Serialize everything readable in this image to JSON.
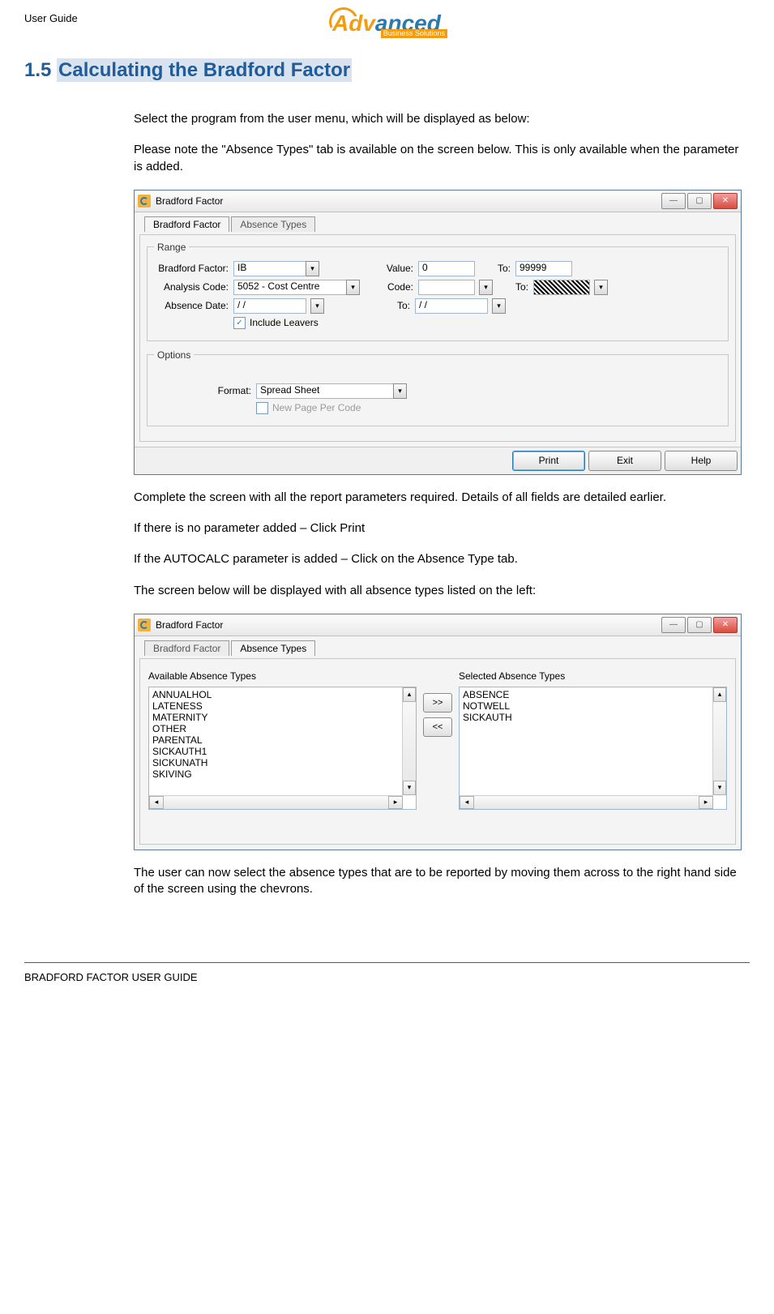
{
  "header": {
    "left_label": "User Guide",
    "logo_orange": "Adv",
    "logo_blue": "anced",
    "logo_sub": "Business Solutions"
  },
  "heading": {
    "number": "1.5",
    "title": "Calculating the Bradford Factor"
  },
  "paragraphs": {
    "p1": "Select the program from the user menu, which will be displayed as below:",
    "p2": "Please note the \"Absence Types\" tab is available on the screen below. This is only available when the parameter is added.",
    "p3": "Complete the screen with all the report parameters required. Details of all fields are detailed earlier.",
    "p4": "If there is no parameter added – Click Print",
    "p5": "If the AUTOCALC parameter is added – Click on the Absence Type tab.",
    "p6": "The screen below will be displayed with all absence types listed on the left:",
    "p7": "The user can now select the absence types that are to be reported by moving them across to the right hand side of the screen using the chevrons."
  },
  "win1": {
    "title": "Bradford Factor",
    "tabs": {
      "t1": "Bradford Factor",
      "t2": "Absence Types"
    },
    "group_range": "Range",
    "group_options": "Options",
    "labels": {
      "bradford_factor": "Bradford Factor:",
      "value": "Value:",
      "to": "To:",
      "analysis_code": "Analysis Code:",
      "code": "Code:",
      "absence_date": "Absence Date:",
      "include_leavers": "Include Leavers",
      "format": "Format:",
      "new_page": "New Page Per Code"
    },
    "values": {
      "bradford_factor": "IB",
      "value": "0",
      "value_to": "99999",
      "analysis_code": "5052 - Cost Centre",
      "code": "",
      "absence_date": "  /    /",
      "absence_to": "  /    /",
      "format": "Spread Sheet"
    },
    "buttons": {
      "print": "Print",
      "exit": "Exit",
      "help": "Help"
    }
  },
  "win2": {
    "title": "Bradford Factor",
    "tabs": {
      "t1": "Bradford Factor",
      "t2": "Absence Types"
    },
    "labels": {
      "available": "Available Absence Types",
      "selected": "Selected Absence Types"
    },
    "available": [
      "ANNUALHOL",
      "LATENESS",
      "MATERNITY",
      "OTHER",
      "PARENTAL",
      "SICKAUTH1",
      "SICKUNATH",
      "SKIVING"
    ],
    "selected": [
      "ABSENCE",
      "NOTWELL",
      "SICKAUTH"
    ],
    "move_right": ">>",
    "move_left": "<<"
  },
  "footer": "BRADFORD FACTOR USER GUIDE"
}
